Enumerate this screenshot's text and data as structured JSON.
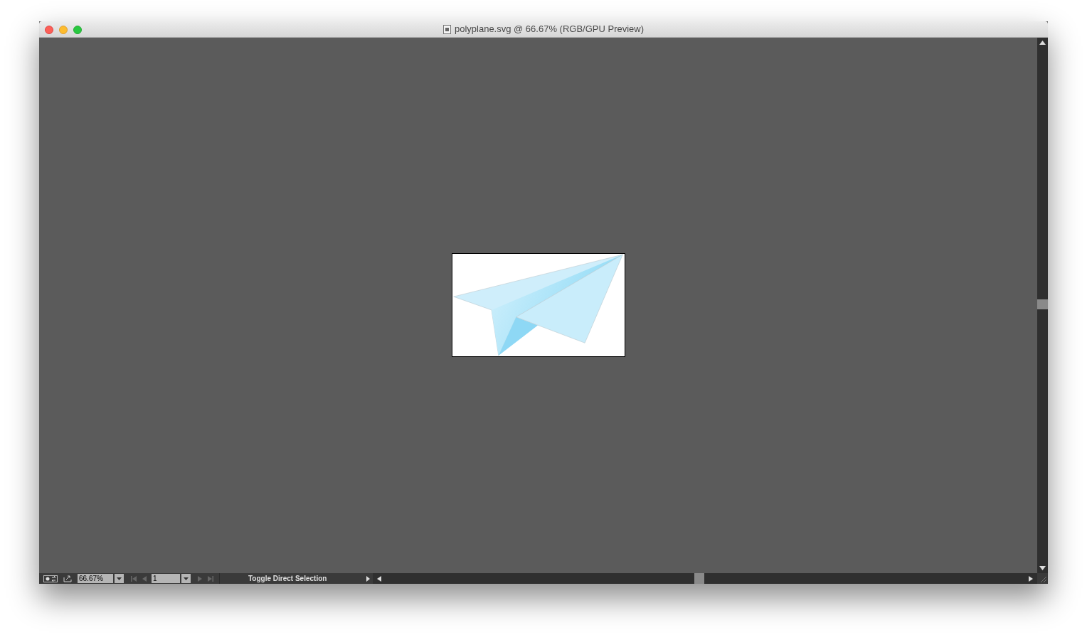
{
  "window": {
    "title": "polyplane.svg @ 66.67% (RGB/GPU Preview)"
  },
  "status_bar": {
    "zoom": "66.67%",
    "artboard": "1",
    "status": "Toggle Direct Selection"
  }
}
